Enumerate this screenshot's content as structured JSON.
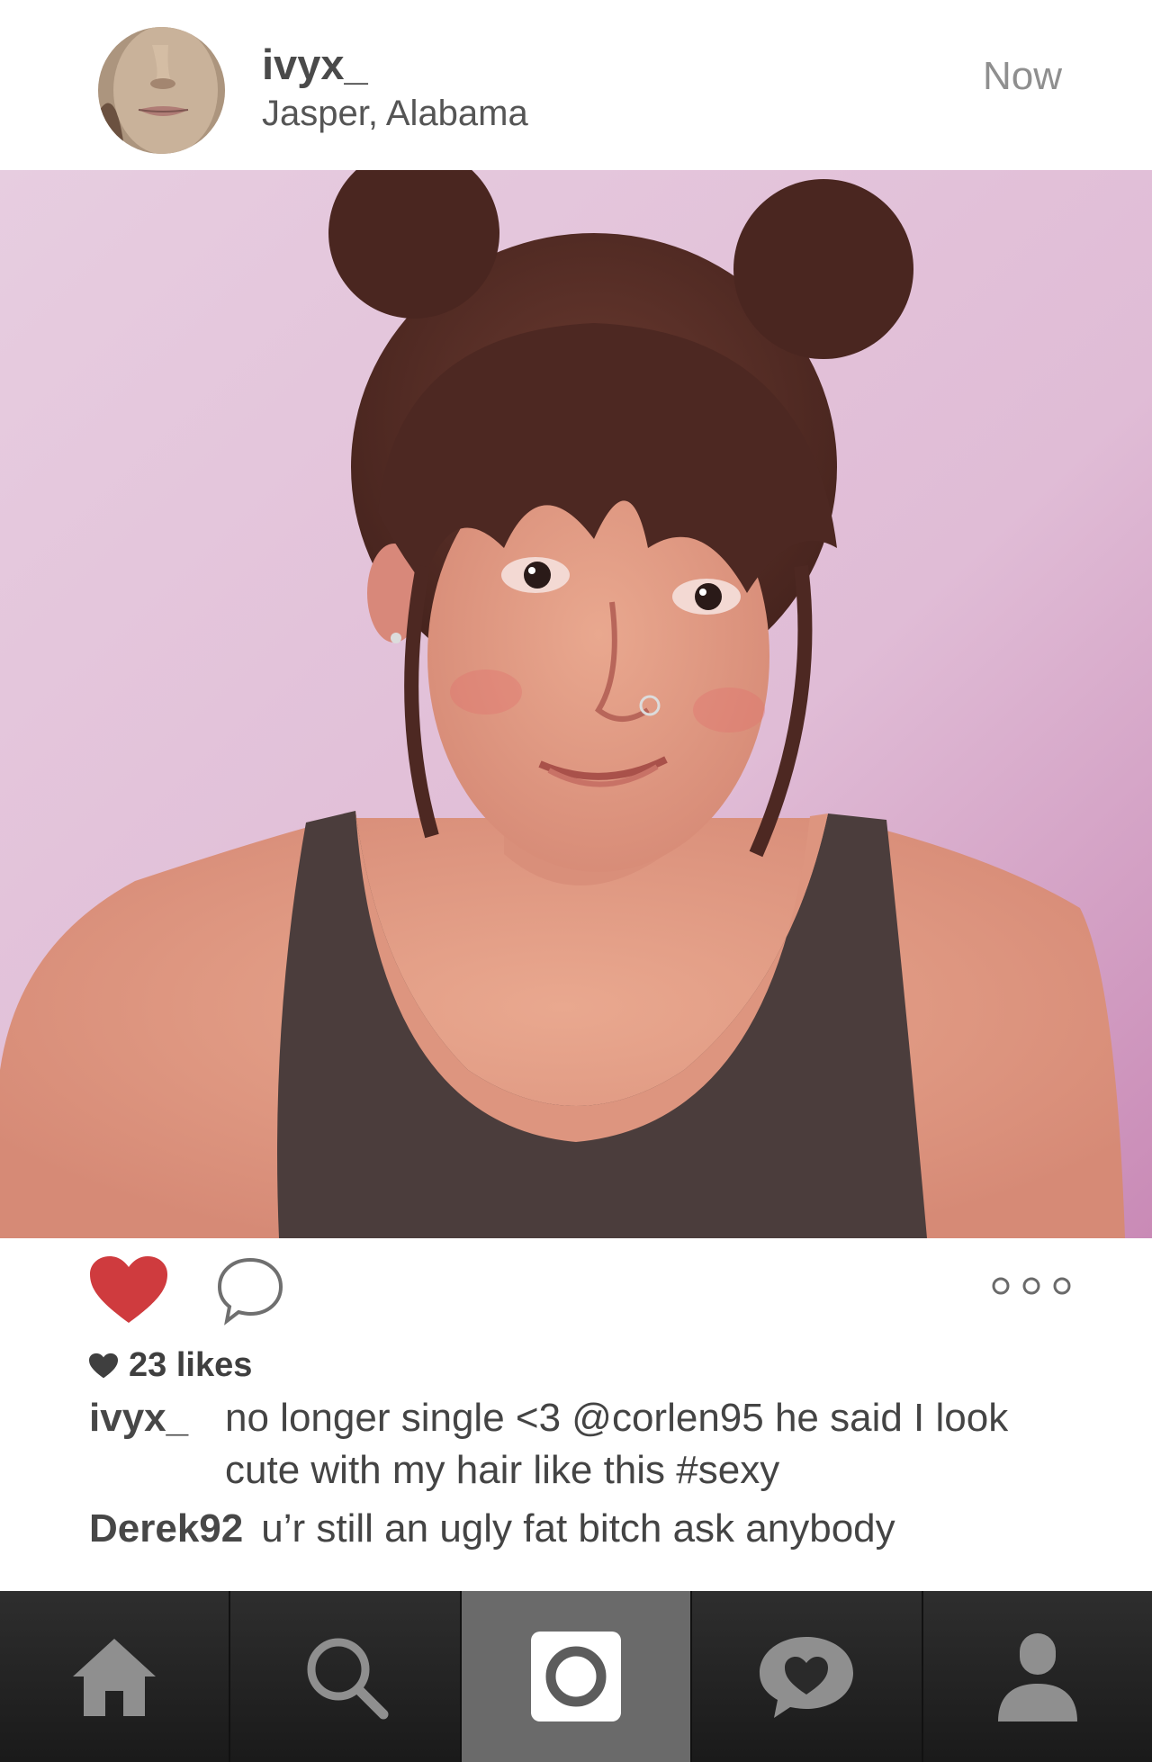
{
  "post": {
    "username": "ivyx_",
    "location": "Jasper, Alabama",
    "timestamp": "Now",
    "likes_label": "23 likes",
    "liked": true
  },
  "captions": [
    {
      "author": "ivyx_",
      "text": "no longer single <3 @corlen95 he said I look cute with my hair like this #sexy"
    },
    {
      "author": "Derek92",
      "text": "u’r still an ugly fat bitch ask anybody"
    }
  ],
  "icons": {
    "like": "heart-icon",
    "comment": "speech-bubble-icon",
    "more": "ellipsis-icon",
    "nav": [
      "home-icon",
      "search-icon",
      "camera-icon",
      "activity-heart-icon",
      "profile-icon"
    ]
  },
  "colors": {
    "like_red": "#cf3b3e",
    "nav_active": "#6a6a6a",
    "nav_bg": "#1c1c1c",
    "photo_bg": "#e2bfd8"
  }
}
